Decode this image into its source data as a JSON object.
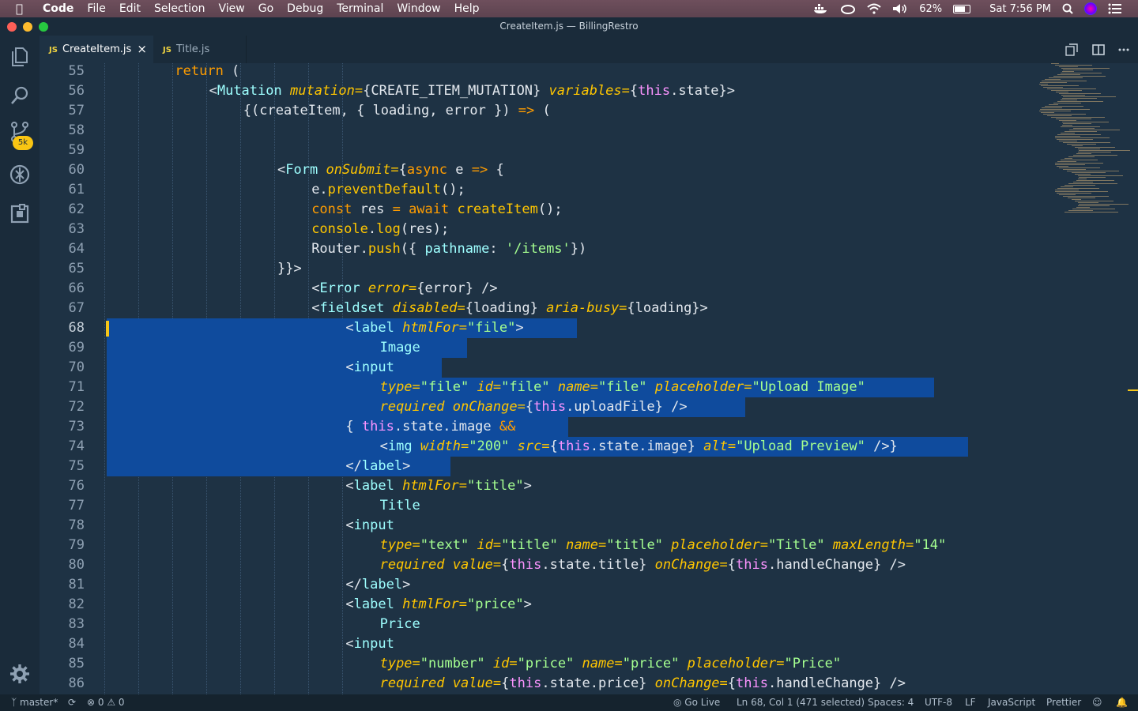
{
  "menubar": {
    "app": "Code",
    "items": [
      "File",
      "Edit",
      "Selection",
      "View",
      "Go",
      "Debug",
      "Terminal",
      "Window",
      "Help"
    ],
    "battery": "62%",
    "clock": "Sat 7:56 PM"
  },
  "window": {
    "title": "CreateItem.js — BillingRestro"
  },
  "activity": {
    "scm_badge": "5k"
  },
  "tabs": [
    {
      "label": "CreateItem.js",
      "badge": "JS",
      "close": "×"
    },
    {
      "label": "Title.js",
      "badge": "JS"
    }
  ],
  "editor": {
    "line_numbers": [
      "55",
      "56",
      "57",
      "58",
      "59",
      "60",
      "61",
      "62",
      "63",
      "64",
      "65",
      "66",
      "67",
      "68",
      "69",
      "70",
      "71",
      "72",
      "73",
      "74",
      "75",
      "76",
      "77",
      "78",
      "79",
      "80",
      "81",
      "82",
      "83",
      "84",
      "85",
      "86"
    ],
    "lines": [
      [
        [
          "kw",
          "return"
        ],
        [
          "plain",
          " ("
        ]
      ],
      [
        [
          "plain",
          "<"
        ],
        [
          "tag",
          "Mutation"
        ],
        [
          "plain",
          " "
        ],
        [
          "attr",
          "mutation="
        ],
        [
          "plain",
          "{CREATE_ITEM_MUTATION} "
        ],
        [
          "attr",
          "variables="
        ],
        [
          "plain",
          "{"
        ],
        [
          "this",
          "this"
        ],
        [
          "plain",
          ".state}>"
        ]
      ],
      [
        [
          "plain",
          "{("
        ],
        [
          "plain",
          "createItem, { loading, error }) "
        ],
        [
          "op",
          "=>"
        ],
        [
          "plain",
          " ("
        ]
      ],
      [],
      [],
      [
        [
          "plain",
          "<"
        ],
        [
          "tag",
          "Form"
        ],
        [
          "plain",
          " "
        ],
        [
          "attr",
          "onSubmit="
        ],
        [
          "plain",
          "{"
        ],
        [
          "kw",
          "async"
        ],
        [
          "plain",
          " e "
        ],
        [
          "op",
          "=>"
        ],
        [
          "plain",
          " {"
        ]
      ],
      [
        [
          "plain",
          "e."
        ],
        [
          "fn",
          "preventDefault"
        ],
        [
          "plain",
          "();"
        ]
      ],
      [
        [
          "kw",
          "const"
        ],
        [
          "plain",
          " res "
        ],
        [
          "op",
          "="
        ],
        [
          "plain",
          " "
        ],
        [
          "kw",
          "await"
        ],
        [
          "plain",
          " "
        ],
        [
          "fn",
          "createItem"
        ],
        [
          "plain",
          "();"
        ]
      ],
      [
        [
          "fn",
          "console"
        ],
        [
          "plain",
          "."
        ],
        [
          "fn",
          "log"
        ],
        [
          "plain",
          "(res);"
        ]
      ],
      [
        [
          "plain",
          "Router."
        ],
        [
          "fn",
          "push"
        ],
        [
          "plain",
          "({ "
        ],
        [
          "prop",
          "pathname"
        ],
        [
          "plain",
          ": "
        ],
        [
          "str",
          "'/items'"
        ],
        [
          "plain",
          "})"
        ]
      ],
      [
        [
          "plain",
          "}}>"
        ]
      ],
      [
        [
          "plain",
          "<"
        ],
        [
          "tag",
          "Error"
        ],
        [
          "plain",
          " "
        ],
        [
          "attr",
          "error="
        ],
        [
          "plain",
          "{error} />"
        ]
      ],
      [
        [
          "plain",
          "<"
        ],
        [
          "tag",
          "fieldset"
        ],
        [
          "plain",
          " "
        ],
        [
          "attr",
          "disabled="
        ],
        [
          "plain",
          "{loading} "
        ],
        [
          "attr",
          "aria-busy="
        ],
        [
          "plain",
          "{loading}>"
        ]
      ],
      [
        [
          "plain",
          "<"
        ],
        [
          "tag",
          "label"
        ],
        [
          "plain",
          " "
        ],
        [
          "attr",
          "htmlFor="
        ],
        [
          "str",
          "\"file\""
        ],
        [
          "plain",
          ">"
        ]
      ],
      [
        [
          "tag",
          "Image"
        ]
      ],
      [
        [
          "plain",
          "<"
        ],
        [
          "tag",
          "input"
        ]
      ],
      [
        [
          "attr",
          "type="
        ],
        [
          "str",
          "\"file\""
        ],
        [
          "plain",
          " "
        ],
        [
          "attr",
          "id="
        ],
        [
          "str",
          "\"file\""
        ],
        [
          "plain",
          " "
        ],
        [
          "attr",
          "name="
        ],
        [
          "str",
          "\"file\""
        ],
        [
          "plain",
          " "
        ],
        [
          "attr",
          "placeholder="
        ],
        [
          "str",
          "\"Upload Image\""
        ]
      ],
      [
        [
          "attr",
          "required"
        ],
        [
          "plain",
          " "
        ],
        [
          "attr",
          "onChange="
        ],
        [
          "plain",
          "{"
        ],
        [
          "this",
          "this"
        ],
        [
          "plain",
          ".uploadFile} />"
        ]
      ],
      [
        [
          "plain",
          "{ "
        ],
        [
          "this",
          "this"
        ],
        [
          "plain",
          ".state.image "
        ],
        [
          "op",
          "&&"
        ]
      ],
      [
        [
          "plain",
          "<"
        ],
        [
          "tag",
          "img"
        ],
        [
          "plain",
          " "
        ],
        [
          "attr",
          "width="
        ],
        [
          "str",
          "\"200\""
        ],
        [
          "plain",
          " "
        ],
        [
          "attr",
          "src="
        ],
        [
          "plain",
          "{"
        ],
        [
          "this",
          "this"
        ],
        [
          "plain",
          ".state.image} "
        ],
        [
          "attr",
          "alt="
        ],
        [
          "str",
          "\"Upload Preview\""
        ],
        [
          "plain",
          " />}"
        ]
      ],
      [
        [
          "plain",
          "</"
        ],
        [
          "tag",
          "label"
        ],
        [
          "plain",
          ">"
        ]
      ],
      [
        [
          "plain",
          "<"
        ],
        [
          "tag",
          "label"
        ],
        [
          "plain",
          " "
        ],
        [
          "attr",
          "htmlFor="
        ],
        [
          "str",
          "\"title\""
        ],
        [
          "plain",
          ">"
        ]
      ],
      [
        [
          "tag",
          "Title"
        ]
      ],
      [
        [
          "plain",
          "<"
        ],
        [
          "tag",
          "input"
        ]
      ],
      [
        [
          "attr",
          "type="
        ],
        [
          "str",
          "\"text\""
        ],
        [
          "plain",
          " "
        ],
        [
          "attr",
          "id="
        ],
        [
          "str",
          "\"title\""
        ],
        [
          "plain",
          " "
        ],
        [
          "attr",
          "name="
        ],
        [
          "str",
          "\"title\""
        ],
        [
          "plain",
          " "
        ],
        [
          "attr",
          "placeholder="
        ],
        [
          "str",
          "\"Title\""
        ],
        [
          "plain",
          " "
        ],
        [
          "attr",
          "maxLength="
        ],
        [
          "str",
          "\"14\""
        ]
      ],
      [
        [
          "attr",
          "required"
        ],
        [
          "plain",
          " "
        ],
        [
          "attr",
          "value="
        ],
        [
          "plain",
          "{"
        ],
        [
          "this",
          "this"
        ],
        [
          "plain",
          ".state.title} "
        ],
        [
          "attr",
          "onChange="
        ],
        [
          "plain",
          "{"
        ],
        [
          "this",
          "this"
        ],
        [
          "plain",
          ".handleChange} />"
        ]
      ],
      [
        [
          "plain",
          "</"
        ],
        [
          "tag",
          "label"
        ],
        [
          "plain",
          ">"
        ]
      ],
      [
        [
          "plain",
          "<"
        ],
        [
          "tag",
          "label"
        ],
        [
          "plain",
          " "
        ],
        [
          "attr",
          "htmlFor="
        ],
        [
          "str",
          "\"price\""
        ],
        [
          "plain",
          ">"
        ]
      ],
      [
        [
          "tag",
          "Price"
        ]
      ],
      [
        [
          "plain",
          "<"
        ],
        [
          "tag",
          "input"
        ]
      ],
      [
        [
          "attr",
          "type="
        ],
        [
          "str",
          "\"number\""
        ],
        [
          "plain",
          " "
        ],
        [
          "attr",
          "id="
        ],
        [
          "str",
          "\"price\""
        ],
        [
          "plain",
          " "
        ],
        [
          "attr",
          "name="
        ],
        [
          "str",
          "\"price\""
        ],
        [
          "plain",
          " "
        ],
        [
          "attr",
          "placeholder="
        ],
        [
          "str",
          "\"Price\""
        ]
      ],
      [
        [
          "attr",
          "required"
        ],
        [
          "plain",
          " "
        ],
        [
          "attr",
          "value="
        ],
        [
          "plain",
          "{"
        ],
        [
          "this",
          "this"
        ],
        [
          "plain",
          ".state.price} "
        ],
        [
          "attr",
          "onChange="
        ],
        [
          "plain",
          "{"
        ],
        [
          "this",
          "this"
        ],
        [
          "plain",
          ".handleChange} />"
        ]
      ]
    ]
  },
  "statusbar": {
    "branch": "master*",
    "errors": "0",
    "warnings": "0",
    "golive": "Go Live",
    "position": "Ln 68, Col 1 (471 selected)",
    "spaces": "Spaces: 4",
    "encoding": "UTF-8",
    "eol": "LF",
    "language": "JavaScript",
    "formatter": "Prettier"
  }
}
